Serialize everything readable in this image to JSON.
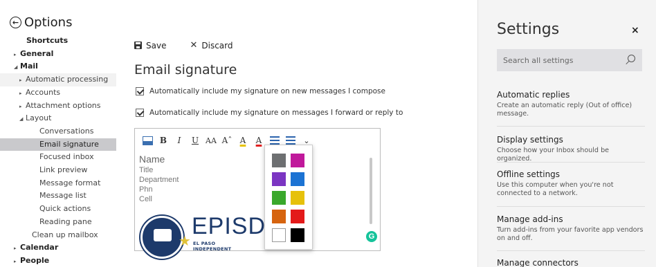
{
  "options": {
    "title": "Options",
    "back_icon": "back-circle-arrow-icon"
  },
  "nav": [
    {
      "label": "Shortcuts",
      "indent": 38,
      "level": "top",
      "caret": "",
      "bold": true
    },
    {
      "label": "General",
      "indent": 30,
      "level": "top",
      "caret": "▸",
      "bold": true
    },
    {
      "label": "Mail",
      "indent": 30,
      "level": "top",
      "caret": "◢",
      "bold": true
    },
    {
      "label": "Automatic processing",
      "indent": 38,
      "caret": "▸"
    },
    {
      "label": "Accounts",
      "indent": 38,
      "caret": "▸"
    },
    {
      "label": "Attachment options",
      "indent": 38,
      "caret": "▸"
    },
    {
      "label": "Layout",
      "indent": 38,
      "caret": "◢"
    },
    {
      "label": "Conversations",
      "indent": 57,
      "caret": ""
    },
    {
      "label": "Email signature",
      "indent": 57,
      "caret": "",
      "selected": true
    },
    {
      "label": "Focused inbox",
      "indent": 57,
      "caret": ""
    },
    {
      "label": "Link preview",
      "indent": 57,
      "caret": ""
    },
    {
      "label": "Message format",
      "indent": 57,
      "caret": ""
    },
    {
      "label": "Message list",
      "indent": 57,
      "caret": ""
    },
    {
      "label": "Quick actions",
      "indent": 57,
      "caret": ""
    },
    {
      "label": "Reading pane",
      "indent": 57,
      "caret": ""
    },
    {
      "label": "Clean up mailbox",
      "indent": 46,
      "caret": ""
    },
    {
      "label": "Calendar",
      "indent": 30,
      "caret": "▸",
      "bold": true
    },
    {
      "label": "People",
      "indent": 30,
      "caret": "▸",
      "bold": true
    }
  ],
  "toolbar": {
    "save_label": "Save",
    "discard_label": "Discard"
  },
  "signature_page": {
    "title": "Email signature",
    "check_new": "Automatically include my signature on new messages I compose",
    "check_reply": "Automatically include my signature on messages I forward or reply to"
  },
  "format_bar": {
    "bold": "B",
    "italic": "I",
    "underline": "U",
    "font_size": "AA",
    "grow_font": "Aˆ",
    "highlight": "A",
    "font_color": "A",
    "more": "⌄"
  },
  "signature": {
    "name": "Name",
    "lines": [
      "Title",
      "Department",
      "Phn",
      "Cell"
    ],
    "logo_text": "EPISD",
    "logo_sub": "EL PASO INDEPENDENT"
  },
  "palette": [
    {
      "color": "#6d6f71"
    },
    {
      "color": "#c0199b"
    },
    {
      "color": "#7b35c2"
    },
    {
      "color": "#1c73d3"
    },
    {
      "color": "#3aa82b"
    },
    {
      "color": "#e6c10b"
    },
    {
      "color": "#d6640f"
    },
    {
      "color": "#e31a1a"
    },
    {
      "color": "#ffffff"
    },
    {
      "color": "#000000"
    }
  ],
  "grammarly_badge": "G",
  "settings": {
    "title": "Settings",
    "close": "×",
    "search_placeholder": "Search all settings",
    "items": [
      {
        "title": "Automatic replies",
        "desc": "Create an automatic reply (Out of office) message."
      },
      {
        "title": "Display settings",
        "desc": "Choose how your Inbox should be organized."
      },
      {
        "title": "Offline settings",
        "desc": "Use this computer when you're not connected to a network."
      },
      {
        "title": "Manage add-ins",
        "desc": "Turn add-ins from your favorite app vendors on and off."
      },
      {
        "title": "Manage connectors",
        "desc": ""
      }
    ]
  }
}
